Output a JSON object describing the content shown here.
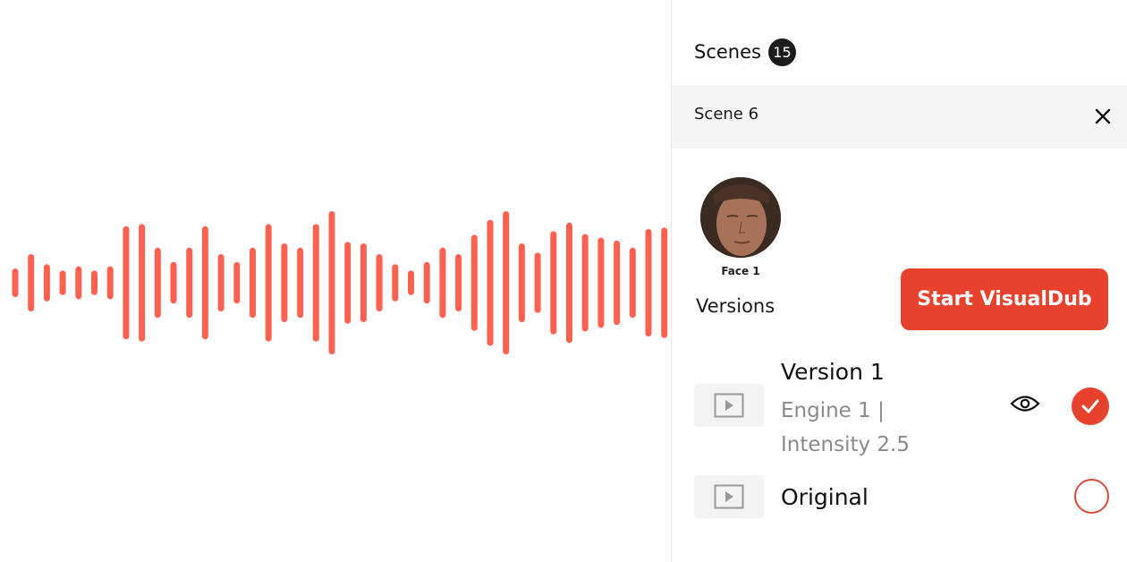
{
  "waveform": {
    "color": "#ff6151",
    "levels": [
      0.2,
      0.4,
      0.26,
      0.17,
      0.23,
      0.17,
      0.23,
      0.79,
      0.82,
      0.49,
      0.29,
      0.49,
      0.79,
      0.4,
      0.29,
      0.49,
      0.82,
      0.55,
      0.49,
      0.82,
      1.0,
      0.57,
      0.55,
      0.4,
      0.26,
      0.17,
      0.29,
      0.49,
      0.4,
      0.67,
      0.88,
      1.0,
      0.55,
      0.42,
      0.72,
      0.84,
      0.68,
      0.63,
      0.59,
      0.49,
      0.75,
      0.77,
      0.33,
      0.2
    ]
  },
  "panel": {
    "scenes_label": "Scenes",
    "scenes_count": "15",
    "scene_name": "Scene 6",
    "close_icon": "close-icon",
    "face_label": "Face 1",
    "versions_label": "Versions",
    "start_button": "Start VisualDub",
    "accent": "#e8422f",
    "versions": [
      {
        "title": "Version 1",
        "subtitle": "Engine 1 | Intensity 2.5",
        "selected": true
      },
      {
        "title": "Original",
        "selected": false
      }
    ]
  }
}
